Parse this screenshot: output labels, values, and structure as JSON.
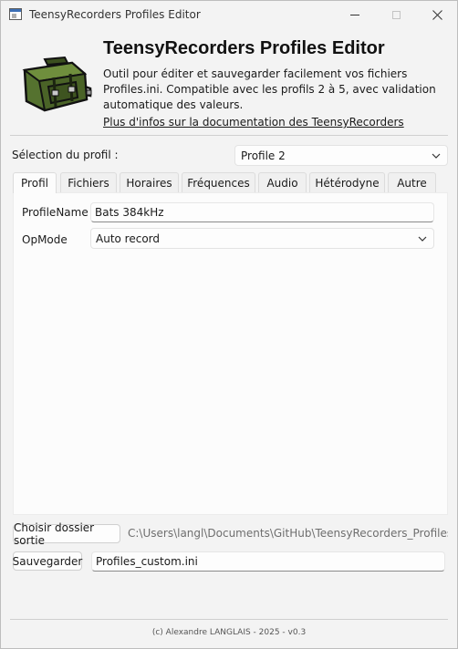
{
  "window": {
    "title": "TeensyRecorders Profiles Editor",
    "controls": [
      "minimize",
      "maximize",
      "close"
    ]
  },
  "header": {
    "title": "TeensyRecorders Profiles Editor",
    "description": "Outil pour éditer et sauvegarder facilement vos fichiers Profiles.ini. Compatible avec les profils 2 à 5, avec validation automatique des valeurs.",
    "link": "Plus d'infos sur la documentation des TeensyRecorders",
    "logo": "green-bag-pixel-art"
  },
  "profile_selection": {
    "label": "Sélection du profil :",
    "value": "Profile 2"
  },
  "tabs": [
    {
      "label": "Profil",
      "active": true
    },
    {
      "label": "Fichiers",
      "active": false
    },
    {
      "label": "Horaires",
      "active": false
    },
    {
      "label": "Fréquences",
      "active": false
    },
    {
      "label": "Audio",
      "active": false
    },
    {
      "label": "Hétérodyne",
      "active": false
    },
    {
      "label": "Autre",
      "active": false
    }
  ],
  "profil_tab": {
    "profile_name_label": "ProfileName",
    "profile_name_value": "Bats 384kHz",
    "opmode_label": "OpMode",
    "opmode_value": "Auto record"
  },
  "output": {
    "choose_folder_label": "Choisir dossier sortie",
    "folder_path": "C:\\Users\\langl\\Documents\\GitHub\\TeensyRecorders_ProfilesEditor",
    "save_label": "Sauvegarder",
    "filename_value": "Profiles_custom.ini"
  },
  "footer": {
    "text": "(c) Alexandre LANGLAIS - 2025 - v0.3"
  },
  "colors": {
    "background": "#f3f3f3",
    "panel": "#fcfcfc",
    "logo_green": "#4f6a2c"
  }
}
